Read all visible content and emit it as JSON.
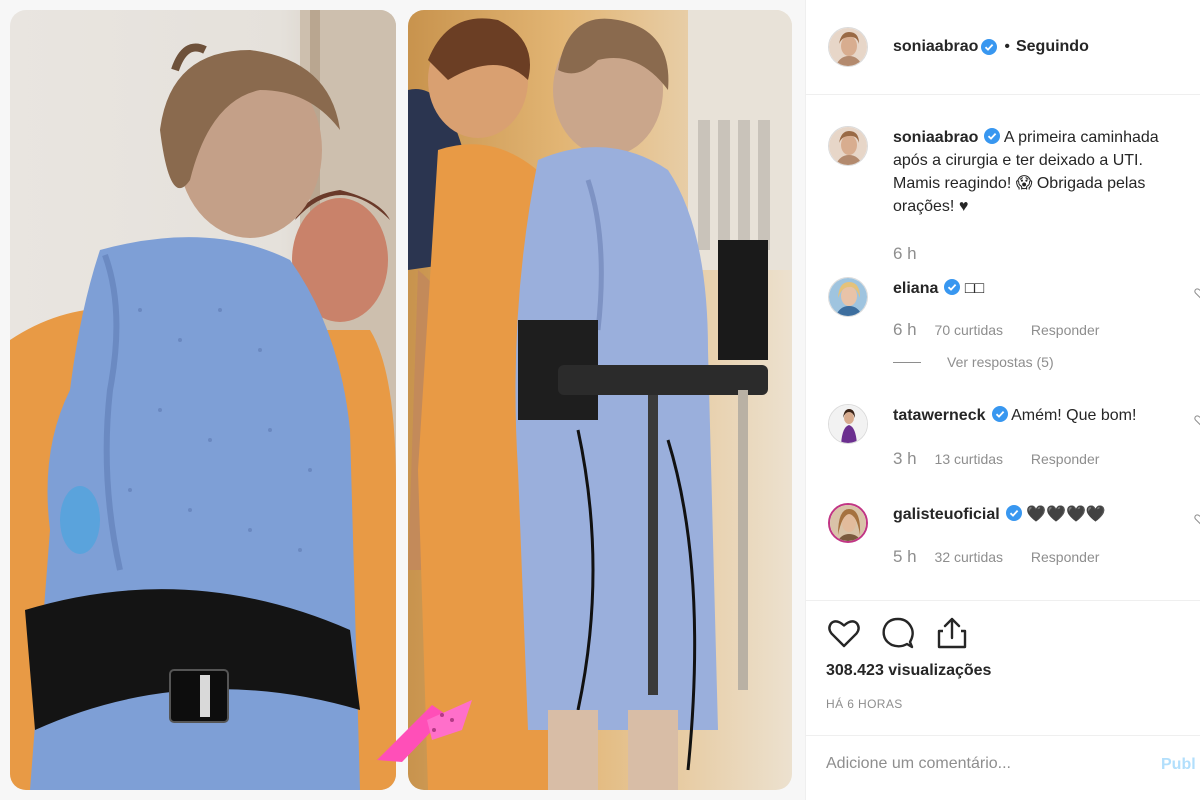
{
  "post": {
    "author": "soniaabrao",
    "follow_separator": "•",
    "follow_status": "Seguindo"
  },
  "caption": {
    "author": "soniaabrao",
    "text": "A primeira caminhada após a cirurgia e ter deixado a UTI. Mamis reagindo! 😱 Obrigada pelas orações! ♥",
    "time": "6 h"
  },
  "comments": [
    {
      "author": "eliana",
      "text": "□□",
      "time": "6 h",
      "likes": "70 curtidas",
      "reply": "Responder",
      "view_replies": "Ver respostas (5)"
    },
    {
      "author": "tatawerneck",
      "text": "Amém! Que bom!",
      "time": "3 h",
      "likes": "13 curtidas",
      "reply": "Responder"
    },
    {
      "author": "galisteuoficial",
      "text": "🖤🖤🖤🖤",
      "time": "5 h",
      "likes": "32 curtidas",
      "reply": "Responder"
    }
  ],
  "actions": {
    "like_icon": "heart-outline-icon",
    "comment_icon": "comment-bubble-icon",
    "share_icon": "share-icon"
  },
  "stats": {
    "views": "308.423 visualizações",
    "posted": "HÁ 6 HORAS"
  },
  "composer": {
    "placeholder": "Adicione um comentário...",
    "publish": "Publ"
  },
  "colors": {
    "text": "#262626",
    "secondary": "#8e8e8e",
    "verified": "#3897f0",
    "divider": "#efefef",
    "publish_disabled": "#b2dffc",
    "gown_blue": "#7e9fd6",
    "scrubs_orange": "#e89a45"
  }
}
